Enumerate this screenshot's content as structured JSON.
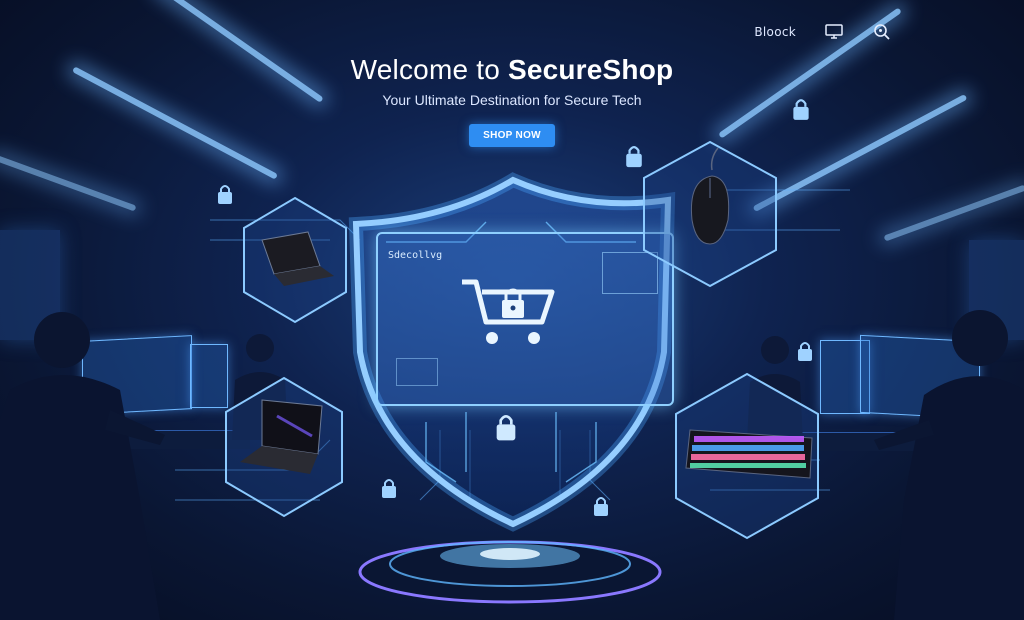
{
  "nav": {
    "link_label": "Bloock",
    "icons": [
      "monitor-icon",
      "search-icon"
    ]
  },
  "hero": {
    "title_prefix": "Welcome to ",
    "title_brand": "SecureShop",
    "subtitle": "Your Ultimate Destination for Secure Tech",
    "cta_label": "SHOP NOW"
  },
  "shield": {
    "screen_label": "Sdecollvg",
    "center_icon": "cart-lock-icon"
  },
  "products": [
    {
      "name": "laptop-top",
      "icon": "laptop-icon"
    },
    {
      "name": "laptop-bottom",
      "icon": "laptop-icon"
    },
    {
      "name": "mouse",
      "icon": "mouse-icon"
    },
    {
      "name": "keyboard",
      "icon": "keyboard-icon"
    }
  ],
  "colors": {
    "background": "#0a1633",
    "glow": "#6fb8ff",
    "accent": "#2e8df2",
    "rgb_keys": "#c05cff"
  }
}
